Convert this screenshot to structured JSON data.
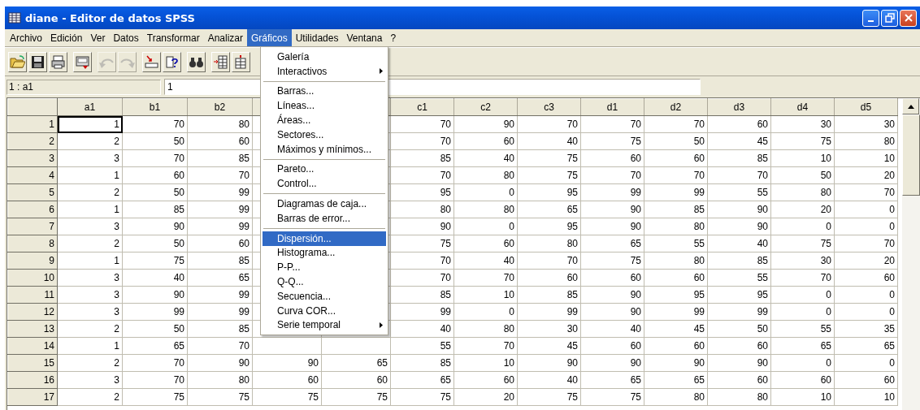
{
  "window": {
    "title": "diane - Editor de datos SPSS"
  },
  "menu_bar": [
    {
      "label": "Archivo",
      "selected": false
    },
    {
      "label": "Edición",
      "selected": false
    },
    {
      "label": "Ver",
      "selected": false
    },
    {
      "label": "Datos",
      "selected": false
    },
    {
      "label": "Transformar",
      "selected": false
    },
    {
      "label": "Analizar",
      "selected": false
    },
    {
      "label": "Gráficos",
      "selected": true
    },
    {
      "label": "Utilidades",
      "selected": false
    },
    {
      "label": "Ventana",
      "selected": false
    },
    {
      "label": "?",
      "selected": false
    }
  ],
  "toolbar": [
    {
      "disabled": false
    },
    {
      "disabled": false
    },
    {
      "disabled": false
    },
    {
      "disabled": false
    },
    {
      "disabled": true
    },
    {
      "disabled": true
    },
    {
      "disabled": false
    },
    {
      "disabled": false
    },
    {
      "disabled": false
    },
    {
      "disabled": false
    },
    {
      "disabled": false
    }
  ],
  "cell_editor": {
    "cell": "1 : a1",
    "value": "1"
  },
  "grid": {
    "columns": [
      {
        "label": "a1",
        "active": true
      },
      {
        "label": "b1",
        "active": false
      },
      {
        "label": "b2",
        "active": false
      },
      {},
      {},
      {
        "label": "c1",
        "active": false
      },
      {
        "label": "c2",
        "active": false
      },
      {
        "label": "c3",
        "active": false
      },
      {
        "label": "d1",
        "active": false
      },
      {
        "label": "d2",
        "active": false
      },
      {
        "label": "d3",
        "active": false
      },
      {
        "label": "d4",
        "active": false
      },
      {
        "label": "d5",
        "active": false
      }
    ],
    "rows": [
      {
        "case": "1",
        "active": true,
        "cells": [
          "1",
          "70",
          "80",
          null,
          null,
          "70",
          "90",
          "70",
          "70",
          "70",
          "60",
          "30",
          "30"
        ]
      },
      {
        "case": "2",
        "cells": [
          "2",
          "50",
          "60",
          null,
          null,
          "70",
          "60",
          "40",
          "75",
          "50",
          "45",
          "75",
          "80"
        ]
      },
      {
        "case": "3",
        "cells": [
          "3",
          "70",
          "85",
          null,
          null,
          "85",
          "40",
          "75",
          "60",
          "60",
          "85",
          "10",
          "10"
        ]
      },
      {
        "case": "4",
        "cells": [
          "1",
          "60",
          "70",
          null,
          null,
          "70",
          "80",
          "75",
          "70",
          "70",
          "70",
          "50",
          "20"
        ]
      },
      {
        "case": "5",
        "cells": [
          "2",
          "50",
          "99",
          null,
          null,
          "95",
          "0",
          "95",
          "99",
          "99",
          "55",
          "80",
          "70"
        ]
      },
      {
        "case": "6",
        "cells": [
          "1",
          "85",
          "99",
          null,
          null,
          "80",
          "80",
          "65",
          "90",
          "85",
          "90",
          "20",
          "0"
        ]
      },
      {
        "case": "7",
        "cells": [
          "3",
          "90",
          "99",
          null,
          null,
          "90",
          "0",
          "95",
          "90",
          "80",
          "90",
          "0",
          "0"
        ]
      },
      {
        "case": "8",
        "cells": [
          "2",
          "50",
          "60",
          null,
          null,
          "75",
          "60",
          "80",
          "65",
          "55",
          "40",
          "75",
          "70"
        ]
      },
      {
        "case": "9",
        "cells": [
          "1",
          "75",
          "85",
          null,
          null,
          "70",
          "40",
          "70",
          "75",
          "80",
          "85",
          "30",
          "20"
        ]
      },
      {
        "case": "10",
        "cells": [
          "3",
          "40",
          "65",
          null,
          null,
          "70",
          "70",
          "60",
          "60",
          "60",
          "55",
          "70",
          "60"
        ]
      },
      {
        "case": "11",
        "cells": [
          "3",
          "90",
          "99",
          null,
          null,
          "85",
          "10",
          "85",
          "90",
          "95",
          "95",
          "0",
          "0"
        ]
      },
      {
        "case": "12",
        "cells": [
          "3",
          "99",
          "99",
          null,
          null,
          "99",
          "0",
          "99",
          "90",
          "99",
          "99",
          "0",
          "0"
        ]
      },
      {
        "case": "13",
        "cells": [
          "2",
          "50",
          "85",
          null,
          null,
          "40",
          "80",
          "30",
          "40",
          "45",
          "50",
          "55",
          "35"
        ]
      },
      {
        "case": "14",
        "cells": [
          "1",
          "65",
          "70",
          null,
          null,
          "55",
          "70",
          "45",
          "60",
          "60",
          "60",
          "65",
          "65"
        ]
      },
      {
        "case": "15",
        "cells": [
          "2",
          "70",
          "90",
          "90",
          "65",
          "85",
          "10",
          "90",
          "90",
          "90",
          "90",
          "0",
          "0"
        ]
      },
      {
        "case": "16",
        "cells": [
          "3",
          "70",
          "80",
          "60",
          "60",
          "65",
          "60",
          "40",
          "65",
          "65",
          "60",
          "60",
          "60"
        ]
      },
      {
        "case": "17",
        "cells": [
          "2",
          "75",
          "75",
          "75",
          "75",
          "75",
          "20",
          "75",
          "75",
          "80",
          "80",
          "10",
          "10"
        ]
      }
    ]
  },
  "dropdown_menu": [
    {
      "kind": "item",
      "label": "Galería",
      "submenu": false,
      "selected": false
    },
    {
      "kind": "item",
      "label": "Interactivos",
      "submenu": true,
      "selected": false
    },
    {
      "kind": "separator"
    },
    {
      "kind": "item",
      "label": "Barras...",
      "submenu": false,
      "selected": false
    },
    {
      "kind": "item",
      "label": "Líneas...",
      "submenu": false,
      "selected": false
    },
    {
      "kind": "item",
      "label": "Áreas...",
      "submenu": false,
      "selected": false
    },
    {
      "kind": "item",
      "label": "Sectores...",
      "submenu": false,
      "selected": false
    },
    {
      "kind": "item",
      "label": "Máximos y mínimos...",
      "submenu": false,
      "selected": false
    },
    {
      "kind": "separator"
    },
    {
      "kind": "item",
      "label": "Pareto...",
      "submenu": false,
      "selected": false
    },
    {
      "kind": "item",
      "label": "Control...",
      "submenu": false,
      "selected": false
    },
    {
      "kind": "separator"
    },
    {
      "kind": "item",
      "label": "Diagramas de caja...",
      "submenu": false,
      "selected": false
    },
    {
      "kind": "item",
      "label": "Barras de error...",
      "submenu": false,
      "selected": false
    },
    {
      "kind": "separator"
    },
    {
      "kind": "item",
      "label": "Dispersión...",
      "submenu": false,
      "selected": true
    },
    {
      "kind": "item",
      "label": "Histograma...",
      "submenu": false,
      "selected": false
    },
    {
      "kind": "item",
      "label": "P-P...",
      "submenu": false,
      "selected": false
    },
    {
      "kind": "item",
      "label": "Q-Q...",
      "submenu": false,
      "selected": false
    },
    {
      "kind": "item",
      "label": "Secuencia...",
      "submenu": false,
      "selected": false
    },
    {
      "kind": "item",
      "label": "Curva COR...",
      "submenu": false,
      "selected": false
    },
    {
      "kind": "item",
      "label": "Serie temporal",
      "submenu": true,
      "selected": false
    }
  ]
}
